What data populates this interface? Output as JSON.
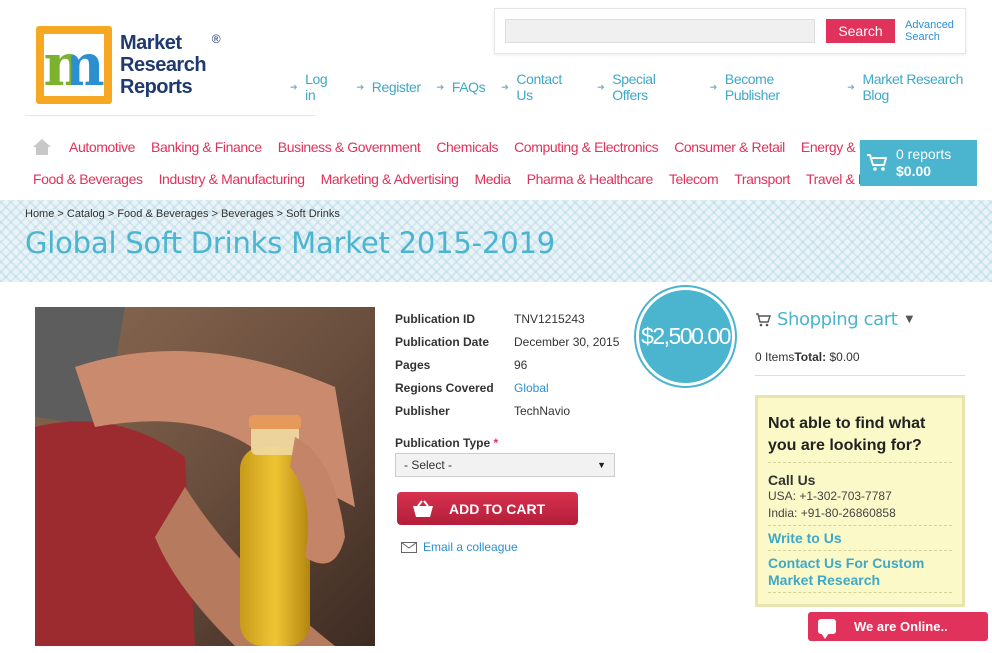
{
  "logo": {
    "line1": "Market",
    "line2": "Research",
    "line3": "Reports",
    "reg": "®"
  },
  "search": {
    "placeholder": "",
    "button": "Search",
    "advanced_line1": "Advanced",
    "advanced_line2": "Search"
  },
  "top_links": [
    "Log in",
    "Register",
    "FAQs",
    "Contact Us",
    "Special Offers",
    "Become Publisher",
    "Market Research Blog"
  ],
  "nav": {
    "row1": [
      "Automotive",
      "Banking & Finance",
      "Business & Government",
      "Chemicals",
      "Computing & Electronics",
      "Consumer & Retail",
      "Energy & Utilities"
    ],
    "row2": [
      "Food & Beverages",
      "Industry & Manufacturing",
      "Marketing & Advertising",
      "Media",
      "Pharma & Healthcare",
      "Telecom",
      "Transport",
      "Travel & Leisure"
    ]
  },
  "cart_widget": {
    "count": "0 reports",
    "total": "$0.00"
  },
  "breadcrumb": "Home > Catalog > Food & Beverages > Beverages > Soft Drinks",
  "title": "Global Soft Drinks Market 2015-2019",
  "details": [
    {
      "label": "Publication ID",
      "value": "TNV1215243",
      "link": false
    },
    {
      "label": "Publication Date",
      "value": "December 30, 2015",
      "link": false
    },
    {
      "label": "Pages",
      "value": "96",
      "link": false
    },
    {
      "label": "Regions Covered",
      "value": "Global",
      "link": true
    },
    {
      "label": "Publisher",
      "value": "TechNavio",
      "link": false
    }
  ],
  "price": "$2,500.00",
  "pub_type": {
    "label": "Publication Type",
    "required": "*",
    "selected": "- Select -"
  },
  "add_to_cart": "ADD TO CART",
  "email_colleague": "Email a colleague",
  "shopping_cart": {
    "title": "Shopping cart",
    "items": "0 Items",
    "total_label": "Total:",
    "total_value": "$0.00"
  },
  "help": {
    "question": "Not able to find what you are looking for?",
    "call_us": "Call Us",
    "phone_usa": "USA: +1-302-703-7787",
    "phone_india": "India: +91-80-26860858",
    "write": "Write to Us",
    "custom": "Contact Us For Custom Market Research"
  },
  "online": "We are Online..",
  "colors": {
    "accent_pink": "#e0325b",
    "accent_blue": "#4bb4cf",
    "help_bg": "#fbf9c8"
  }
}
